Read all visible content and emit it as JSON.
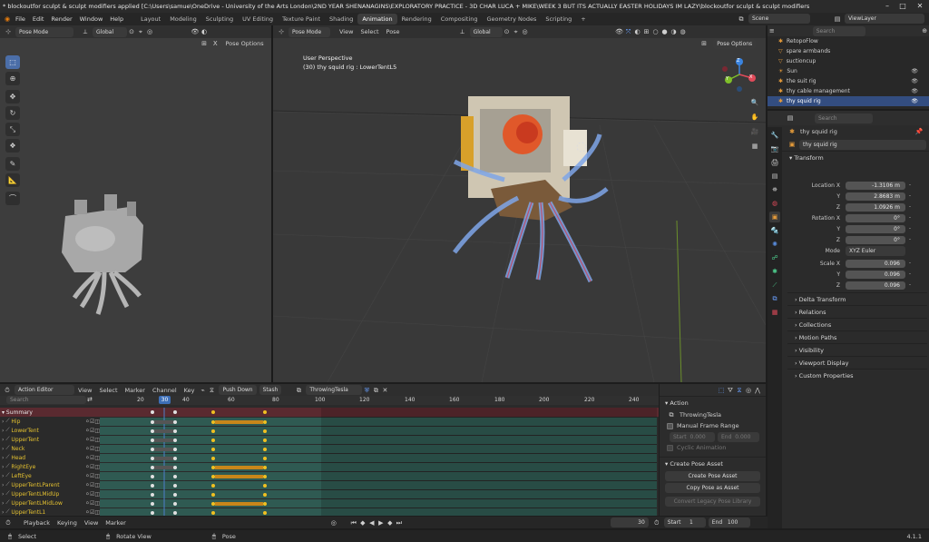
{
  "window": {
    "title": "* blockoutfor sculpt & sculpt modifiers applied [C:\\Users\\samue\\OneDrive - University of the Arts London\\2ND YEAR SHENANAGINS\\EXPLORATORY PRACTICE - 3D CHAR LUCA + MIKE\\WEEK 3 BUT ITS ACTUALLY EASTER HOLIDAYS IM LAZY\\blockoutfor sculpt & sculpt modifiers"
  },
  "menu": [
    "File",
    "Edit",
    "Render",
    "Window",
    "Help"
  ],
  "workspaces": [
    "Layout",
    "Modeling",
    "Sculpting",
    "UV Editing",
    "Texture Paint",
    "Shading",
    "Animation",
    "Rendering",
    "Compositing",
    "Geometry Nodes",
    "Scripting",
    "+"
  ],
  "active_workspace": "Animation",
  "scene": {
    "label": "Scene",
    "view_layer": "ViewLayer"
  },
  "left_viewport": {
    "mode": "Pose Mode",
    "orientation": "Global",
    "pose_options": "Pose Options"
  },
  "main_viewport": {
    "mode": "Pose Mode",
    "menus": [
      "View",
      "Select",
      "Pose"
    ],
    "orientation": "Global",
    "pose_options": "Pose Options",
    "overlay_title": "User Perspective",
    "overlay_sub": "(30) thy squid rig : LowerTentL5",
    "gizmo": {
      "x": "X",
      "y": "Y",
      "z": "Z"
    }
  },
  "outliner": {
    "search_placeholder": "Search",
    "items": [
      {
        "name": "RetopoFlow"
      },
      {
        "name": "spare armbands"
      },
      {
        "name": "suctioncup"
      },
      {
        "name": "Sun"
      },
      {
        "name": "the suit rig"
      },
      {
        "name": "thy cable management"
      },
      {
        "name": "thy squid rig"
      }
    ]
  },
  "properties": {
    "search_placeholder": "Search",
    "object_path": "thy squid rig",
    "object_name": "thy squid rig",
    "transform_title": "Transform",
    "location": {
      "label": "Location X",
      "x": "-1.3106 m",
      "y": "2.8683 m",
      "z": "1.0926 m"
    },
    "rotation": {
      "label": "Rotation X",
      "x": "0°",
      "y": "0°",
      "z": "0°"
    },
    "mode_label": "Mode",
    "mode_value": "XYZ Euler",
    "scale": {
      "label": "Scale X",
      "x": "0.096",
      "y": "0.096",
      "z": "0.096"
    },
    "axis_y": "Y",
    "axis_z": "Z",
    "panels": [
      "Delta Transform",
      "Relations",
      "Collections",
      "Motion Paths",
      "Visibility",
      "Viewport Display",
      "Custom Properties"
    ]
  },
  "action_editor": {
    "mode": "Action Editor",
    "menus": [
      "View",
      "Select",
      "Marker",
      "Channel",
      "Key"
    ],
    "push_down": "Push Down",
    "stash": "Stash",
    "action_name": "ThrowingTesla",
    "search_placeholder": "Search",
    "current_frame": "30",
    "frame_ticks": [
      "20",
      "40",
      "60",
      "80",
      "100",
      "120",
      "140",
      "160",
      "180",
      "200",
      "220",
      "240"
    ],
    "channels": [
      "Summary",
      "Hip",
      "LowerTent",
      "UpperTent",
      "Neck",
      "Head",
      "RightEye",
      "LeftEye",
      "UpperTentLParent",
      "UpperTentLMidUp",
      "UpperTentLMidLow",
      "UpperTentL1"
    ]
  },
  "action_side": {
    "action_title": "Action",
    "action_name": "ThrowingTesla",
    "manual_frame_range": "Manual Frame Range",
    "start_label": "Start",
    "start_value": "0.000",
    "end_label": "End",
    "end_value": "0.000",
    "cyclic": "Cyclic Animation",
    "pose_asset_title": "Create Pose Asset",
    "create_pose_asset": "Create Pose Asset",
    "copy_pose_asset": "Copy Pose as Asset",
    "convert_legacy": "Convert Legacy Pose Library"
  },
  "timeline": {
    "menus": [
      "Playback",
      "Keying",
      "View",
      "Marker"
    ],
    "frame": "30",
    "start_label": "Start",
    "start_value": "1",
    "end_label": "End",
    "end_value": "100"
  },
  "statusbar": {
    "select": "Select",
    "rotate": "Rotate View",
    "pose": "Pose",
    "version": "4.1.1"
  },
  "colors": {
    "accent": "#4b6ea8",
    "channel_text": "#e5c230",
    "key_strip": "#2f5a52",
    "summary": "#5a2a30",
    "keyframe_bar": "#c8861a"
  }
}
